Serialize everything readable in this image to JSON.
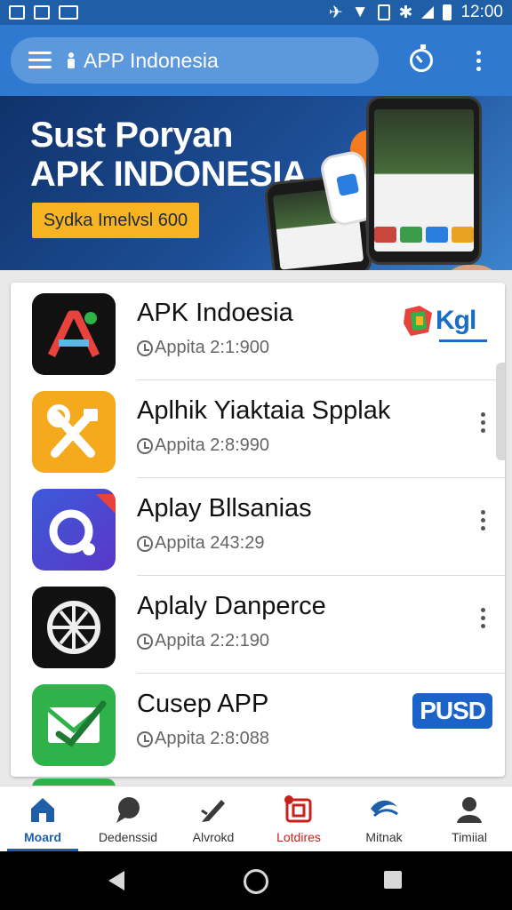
{
  "status_bar": {
    "time": "12:00"
  },
  "app_bar": {
    "title": "APP Indonesia"
  },
  "banner": {
    "line1": "Sust Poryan",
    "line2": "APK INDONESIA",
    "cta": "Sydka Imelvsl 600"
  },
  "apps": [
    {
      "name": "APK Indoesia",
      "meta": "Appita 2:1:900",
      "icon": "a-letter-icon",
      "badge": "Kgl",
      "has_menu": false
    },
    {
      "name": "Aplhik Yiaktaia Spplak",
      "meta": "Appita 2:8:990",
      "icon": "scissors-icon",
      "badge": "",
      "has_menu": true
    },
    {
      "name": "Aplay Bllsanias",
      "meta": "Appita 243:29",
      "icon": "ring-icon",
      "badge": "",
      "has_menu": true
    },
    {
      "name": "Aplaly Danperce",
      "meta": "Appita 2:2:190",
      "icon": "film-reel-icon",
      "badge": "",
      "has_menu": true
    },
    {
      "name": "Cusep APP",
      "meta": "Appita 2:8:088",
      "icon": "mail-check-icon",
      "badge": "PUSD",
      "has_menu": false
    }
  ],
  "bottom_nav": [
    {
      "label": "Moard",
      "icon": "home-icon",
      "active": true
    },
    {
      "label": "Dedenssid",
      "icon": "chat-bubble-icon",
      "active": false
    },
    {
      "label": "Alvrokd",
      "icon": "pen-icon",
      "active": false
    },
    {
      "label": "Lotdires",
      "icon": "screen-record-icon",
      "active": false
    },
    {
      "label": "Mitnak",
      "icon": "wave-logo-icon",
      "active": false
    },
    {
      "label": "Timiial",
      "icon": "person-icon",
      "active": false
    }
  ],
  "colors": {
    "primary": "#2f7ad0",
    "primary_dark": "#1f5fa8",
    "accent": "#f7b320",
    "badge_blue": "#1b63c8"
  }
}
